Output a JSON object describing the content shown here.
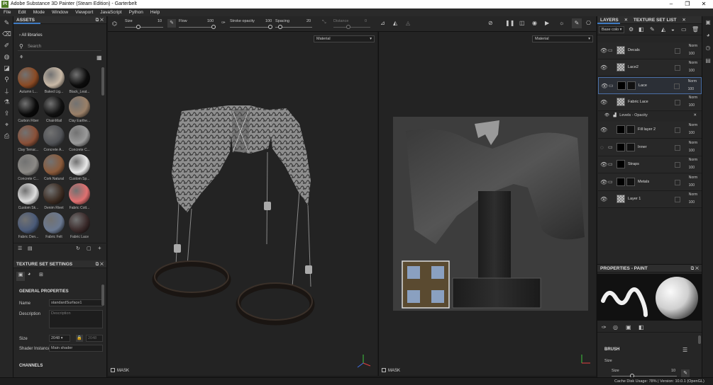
{
  "window": {
    "title": "Adobe Substance 3D Painter (Steam Edition) - Garterbelt",
    "app_icon": "Pt"
  },
  "menu": [
    "File",
    "Edit",
    "Mode",
    "Window",
    "Viewport",
    "JavaScript",
    "Python",
    "Help"
  ],
  "assets": {
    "title": "ASSETS",
    "breadcrumb": "All libraries",
    "search_placeholder": "Search",
    "materials": [
      {
        "name": "Autumn L...",
        "color": "#8a4a24"
      },
      {
        "name": "Baked Lig...",
        "color": "#c9b9a6"
      },
      {
        "name": "Black_Leat...",
        "color": "#0c0c0c"
      },
      {
        "name": "Carbon Fiber",
        "color": "#0a0a0a"
      },
      {
        "name": "ChainMail",
        "color": "#111111"
      },
      {
        "name": "Clay Earthe...",
        "color": "#9a8068"
      },
      {
        "name": "Clay Terrac...",
        "color": "#8a5038"
      },
      {
        "name": "Concrete A...",
        "color": "#505256"
      },
      {
        "name": "Concrete C...",
        "color": "#9a9a9a"
      },
      {
        "name": "Concrete C...",
        "color": "#8c8a86"
      },
      {
        "name": "Cork Natural",
        "color": "#8a5a3a"
      },
      {
        "name": "Custom Sp...",
        "color": "#e8e8e8"
      },
      {
        "name": "Custom Sk...",
        "color": "#dddddd"
      },
      {
        "name": "Denim Rivet",
        "color": "#3c2c22"
      },
      {
        "name": "Fabric Cott...",
        "color": "#e07070"
      },
      {
        "name": "Fabric Den...",
        "color": "#4a5a78"
      },
      {
        "name": "Fabric Felt",
        "color": "#6a7890"
      },
      {
        "name": "Fabric Lace",
        "color": "#3a2a2a"
      }
    ]
  },
  "texture_set_settings": {
    "title": "TEXTURE SET SETTINGS",
    "section": "GENERAL PROPERTIES",
    "name_label": "Name",
    "name_value": "standardSurface1",
    "description_label": "Description",
    "description_placeholder": "Description",
    "size_label": "Size",
    "size_value": "2048",
    "size_linked": "2048",
    "shader_label": "Shader Instance",
    "shader_value": "Main shader",
    "channels": "CHANNELS"
  },
  "toolbar": {
    "size_label": "Size",
    "size_value": "10",
    "flow_label": "Flow",
    "flow_value": "100",
    "stroke_label": "Stroke opacity",
    "stroke_value": "100",
    "spacing_label": "Spacing",
    "spacing_value": "20",
    "distance_label": "Distance",
    "distance_value": "0"
  },
  "viewport3d": {
    "dropdown": "Material",
    "mask_label": "MASK"
  },
  "viewport2d": {
    "dropdown": "Material",
    "mask_label": "MASK"
  },
  "layers": {
    "tab_layers": "LAYERS",
    "tab_texture_set": "TEXTURE SET LIST",
    "channel_select": "Base colo",
    "items": [
      {
        "name": "Decals",
        "blend": "Norm",
        "opacity": "100",
        "folder": true
      },
      {
        "name": "Lace2",
        "blend": "Norm",
        "opacity": "100",
        "folder": false
      },
      {
        "name": "Lace",
        "blend": "Norm",
        "opacity": "100",
        "folder": true
      },
      {
        "name": "Fabric Lace",
        "blend": "Norm",
        "opacity": "100",
        "folder": false
      },
      {
        "name": "Fill layer 2",
        "blend": "Norm",
        "opacity": "100",
        "folder": false
      },
      {
        "name": "Inner",
        "blend": "Norm",
        "opacity": "100",
        "folder": true
      },
      {
        "name": "Straps",
        "blend": "Norm",
        "opacity": "100",
        "folder": true
      },
      {
        "name": "Metals",
        "blend": "Norm",
        "opacity": "100",
        "folder": true
      },
      {
        "name": "Layer 1",
        "blend": "Norm",
        "opacity": "100",
        "folder": false
      }
    ],
    "effect": "Levels - Opacity"
  },
  "properties": {
    "title": "PROPERTIES - PAINT",
    "brush_label": "BRUSH",
    "size_label": "Size",
    "size_label2": "Size",
    "size_value": "10"
  },
  "status": {
    "text": "Cache Disk Usage:   78% | Version: 10.0.1 (OpenGL)"
  },
  "colors": {
    "accent": "#3e7bc4",
    "panel": "#262626",
    "viewport": "#232323"
  }
}
